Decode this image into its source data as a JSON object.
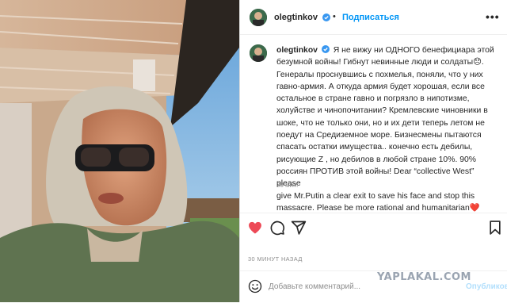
{
  "post": {
    "username": "olegtinkov",
    "follow_label": "Подписаться",
    "more_label": "•••",
    "caption_user": "olegtinkov",
    "caption_lines": [
      "Я не вижу ни ОДНОГО бенефициара этой",
      "безумной войны! Гибнут невинные люди и солдаты😞.",
      "Генералы проснувшись с похмелья, поняли, что у них",
      "гавно-армия. А откуда армия будет хорошая, если все",
      "остальное в стране гавно и погрязло в нипотизме,",
      "холуйстве и чинопочитании? Кремлевские чиновники в",
      "шоке, что не только они, но и их дети теперь летом не",
      "поедут на Средиземное море. Бизнесмены пытаются",
      "спасать остатки имущества.. конечно есть дебилы,",
      "рисующие Z , но дебилов в любой стране 10%. 90%",
      "россиян ПРОТИВ этой войны! Dear “collective West” please",
      "give Mr.Putin a clear exit to save his face and stop this",
      "massacre. Please be more rational and humanitarian❤️"
    ],
    "caption_time": "30 мин.",
    "timestamp": "30 МИНУТ НАЗАД"
  },
  "actions": {
    "like_icon": "heart-filled-icon",
    "comment_icon": "comment-icon",
    "share_icon": "send-icon",
    "save_icon": "bookmark-icon"
  },
  "comment": {
    "placeholder": "Добавьте комментарий...",
    "publish_label": "Опубликовать",
    "emoji_icon": "smiley-icon"
  },
  "watermark": "YAPLAKAL.COM",
  "colors": {
    "accent": "#0095f6",
    "like": "#ed4956",
    "verified": "#3897f0",
    "muted": "#8e8e8e"
  }
}
